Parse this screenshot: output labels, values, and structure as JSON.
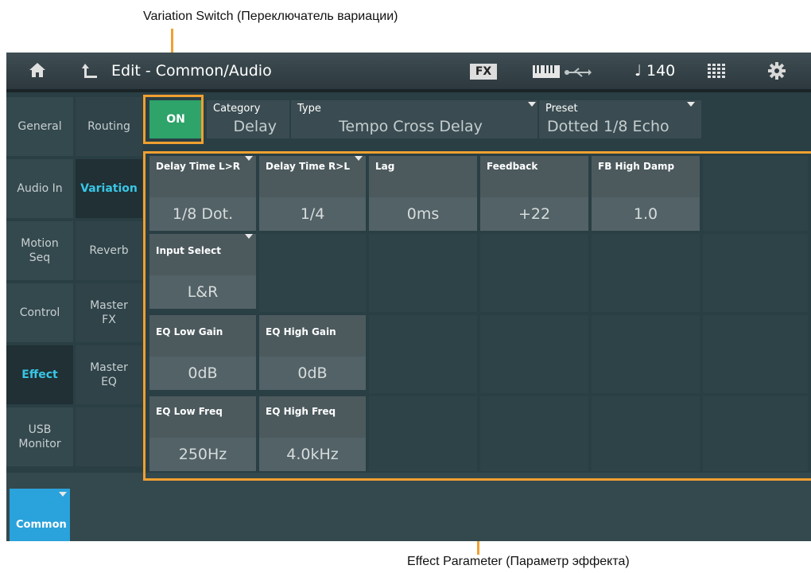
{
  "annotations": {
    "variation_switch": "Variation Switch (Переключатель вариации)",
    "effect_parameter": "Effect Parameter (Параметр эффекта)"
  },
  "titlebar": {
    "title": "Edit - Common/Audio",
    "fx_badge": "FX",
    "tempo": "♩ 140",
    "icons": [
      "home-icon",
      "back-arrow-icon",
      "keyboard-icon",
      "usb-icon",
      "grid-icon",
      "gear-icon"
    ]
  },
  "sidebar_col1": [
    {
      "label": "General",
      "active": false
    },
    {
      "label": "Audio In",
      "active": false
    },
    {
      "label": "Motion\nSeq",
      "active": false
    },
    {
      "label": "Control",
      "active": false
    },
    {
      "label": "Effect",
      "active": true
    },
    {
      "label": "USB\nMonitor",
      "active": false
    }
  ],
  "sidebar_col2": [
    {
      "label": "Routing",
      "active": false
    },
    {
      "label": "Variation",
      "active": true
    },
    {
      "label": "Reverb",
      "active": false
    },
    {
      "label": "Master\nFX",
      "active": false
    },
    {
      "label": "Master\nEQ",
      "active": false
    }
  ],
  "switch": {
    "label": "ON",
    "state": "on"
  },
  "category": {
    "label": "Category",
    "value": "Delay"
  },
  "type": {
    "label": "Type",
    "value": "Tempo Cross Delay"
  },
  "preset": {
    "label": "Preset",
    "value": "Dotted 1/8 Echo"
  },
  "params": {
    "delay_time_lr": {
      "label": "Delay Time L>R",
      "value": "1/8 Dot."
    },
    "delay_time_rl": {
      "label": "Delay Time R>L",
      "value": "1/4"
    },
    "lag": {
      "label": "Lag",
      "value": "0ms"
    },
    "feedback": {
      "label": "Feedback",
      "value": "+22"
    },
    "fb_high_damp": {
      "label": "FB High Damp",
      "value": "1.0"
    },
    "input_select": {
      "label": "Input Select",
      "value": "L&R"
    },
    "eq_low_gain": {
      "label": "EQ Low Gain",
      "value": "0dB"
    },
    "eq_high_gain": {
      "label": "EQ High Gain",
      "value": "0dB"
    },
    "eq_low_freq": {
      "label": "EQ Low Freq",
      "value": "250Hz"
    },
    "eq_high_freq": {
      "label": "EQ High Freq",
      "value": "4.0kHz"
    }
  },
  "bottom": {
    "common_label": "Common"
  },
  "colors": {
    "accent_orange": "#f0a030",
    "active_cyan": "#39c6e6",
    "on_green": "#2ea36a",
    "common_blue": "#2aa2db"
  }
}
